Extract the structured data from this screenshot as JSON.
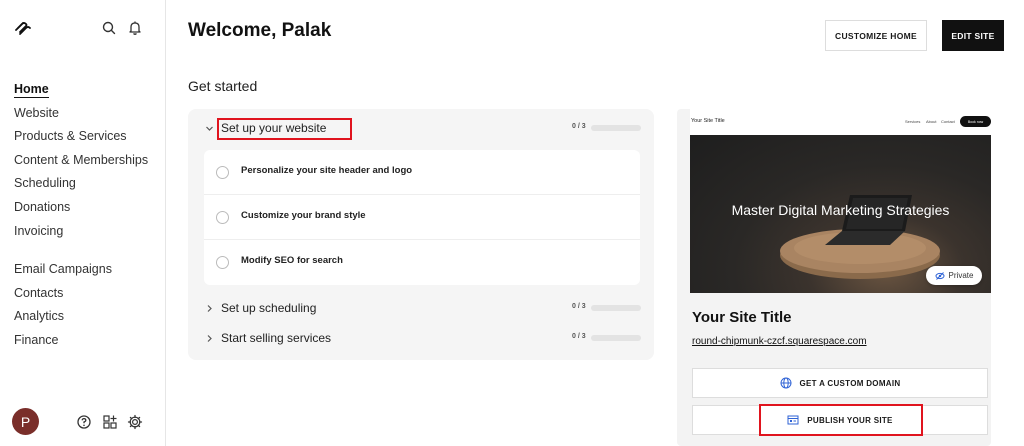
{
  "sidebar": {
    "logo_icon": "squarespace-logo-icon",
    "nav_primary": [
      {
        "label": "Home",
        "active": true
      },
      {
        "label": "Website"
      },
      {
        "label": "Products & Services"
      },
      {
        "label": "Content & Memberships"
      },
      {
        "label": "Scheduling"
      },
      {
        "label": "Donations"
      },
      {
        "label": "Invoicing"
      }
    ],
    "nav_secondary": [
      {
        "label": "Email Campaigns"
      },
      {
        "label": "Contacts"
      },
      {
        "label": "Analytics"
      },
      {
        "label": "Finance"
      }
    ],
    "avatar_initial": "P"
  },
  "header": {
    "welcome": "Welcome, Palak",
    "customize_home": "CUSTOMIZE HOME",
    "edit_site": "EDIT SITE"
  },
  "get_started": {
    "title": "Get started",
    "groups": [
      {
        "label": "Set up your website",
        "expanded": true,
        "progress_text": "0 / 3",
        "progress": 0,
        "tasks": [
          {
            "label": "Personalize your site header and logo"
          },
          {
            "label": "Customize your brand style"
          },
          {
            "label": "Modify SEO for search"
          }
        ]
      },
      {
        "label": "Set up scheduling",
        "expanded": false,
        "progress_text": "0 / 3",
        "progress": 0
      },
      {
        "label": "Start selling services",
        "expanded": false,
        "progress_text": "0 / 3",
        "progress": 0
      }
    ]
  },
  "preview": {
    "mini_title": "Your Site Title",
    "mini_links": [
      "Services",
      "About",
      "Contact"
    ],
    "mini_button": "Book now",
    "hero_text": "Master Digital Marketing Strategies",
    "private_label": "Private",
    "site_title": "Your Site Title",
    "site_url": "round-chipmunk-czcf.squarespace.com",
    "custom_domain": "GET A CUSTOM DOMAIN",
    "publish": "PUBLISH YOUR SITE"
  },
  "colors": {
    "highlight": "#e0141e",
    "dark": "#111111",
    "avatar": "#7a2e2a"
  }
}
